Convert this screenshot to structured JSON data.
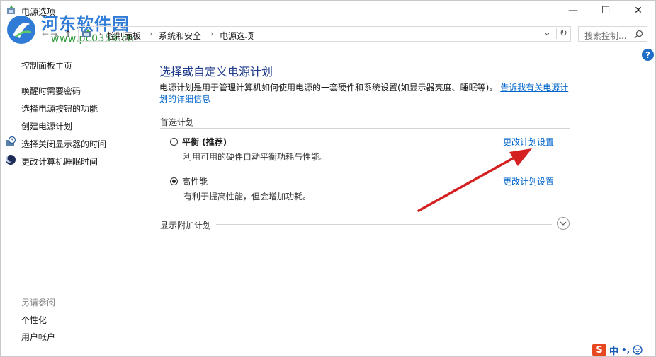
{
  "window": {
    "title": "电源选项",
    "minimize_glyph": "—",
    "maximize_glyph": "☐",
    "close_glyph": "✕"
  },
  "watermark": {
    "name": "河东软件园",
    "url": "www.pc0359.cn"
  },
  "nav": {
    "back_glyph": "←",
    "forward_glyph": "→",
    "recent_glyph": "⌄",
    "up_glyph": "↑",
    "breadcrumb": [
      "控制面板",
      "系统和安全",
      "电源选项"
    ],
    "crumb_sep": "›",
    "dropdown_glyph": "⌄",
    "refresh_glyph": "↻",
    "search_placeholder": "搜索控制..."
  },
  "help_label": "?",
  "sidebar": {
    "home": "控制面板主页",
    "links": [
      "唤醒时需要密码",
      "选择电源按钮的功能",
      "创建电源计划",
      "选择关闭显示器的时间",
      "更改计算机睡眠时间"
    ],
    "see_also_label": "另请参阅",
    "see_also": [
      "个性化",
      "用户帐户"
    ]
  },
  "main": {
    "heading": "选择或自定义电源计划",
    "description": "电源计划是用于管理计算机如何使用电源的一套硬件和系统设置(如显示器亮度、睡眠等)。",
    "description_link": "告诉我有关电源计划的详细信息",
    "preferred_label": "首选计划",
    "plans": [
      {
        "name": "平衡 (推荐)",
        "desc": "利用可用的硬件自动平衡功耗与性能。",
        "link": "更改计划设置",
        "selected": false
      },
      {
        "name": "高性能",
        "desc": "有利于提高性能，但会增加功耗。",
        "link": "更改计划设置",
        "selected": true
      }
    ],
    "additional_label": "显示附加计划"
  },
  "ime": {
    "logo": "S",
    "mode": "中",
    "punct": "•,"
  },
  "colors": {
    "link": "#0066cc",
    "heading": "#1e3a8a",
    "arrow": "#d42020"
  }
}
